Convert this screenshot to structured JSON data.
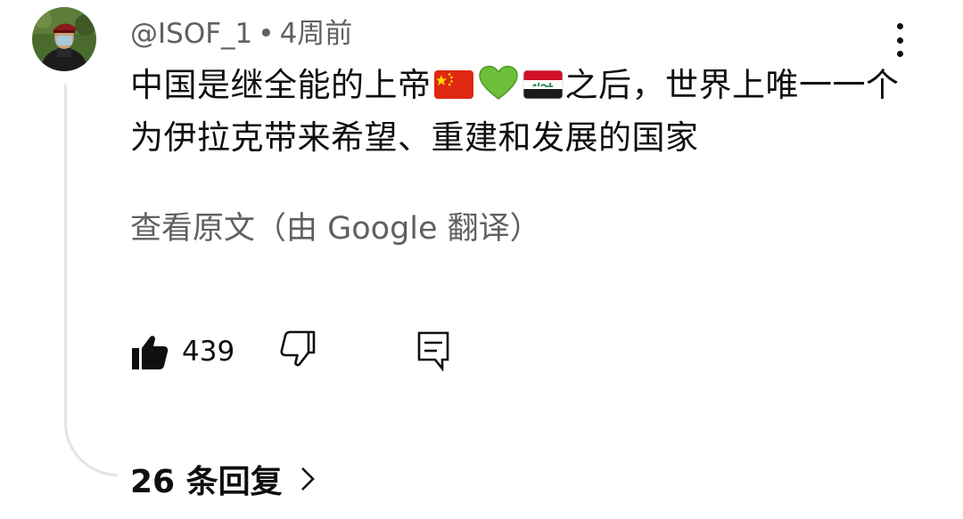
{
  "comment": {
    "author": "@ISOF_1",
    "separator": "•",
    "time": "4周前",
    "text_before_emoji": "中国是继全能的上帝",
    "emojis": [
      "china-flag-icon",
      "green-heart-icon",
      "iraq-flag-icon"
    ],
    "text_after_emoji": "之后，世界上唯一一个为伊拉克带来希望、重建和发展的国家",
    "translation_link": "查看原文（由 Google 翻译）",
    "like_count": "439",
    "replies_label": "26 条回复"
  },
  "colors": {
    "primary_text": "#0f0f0f",
    "secondary_text": "#606060",
    "thread_line": "#e4e4e4",
    "china_red": "#de2910",
    "china_yellow": "#ffde00",
    "iraq_red": "#ce1126",
    "iraq_green": "#007a3d",
    "heart_green": "#6dbf3a"
  },
  "icons": {
    "menu": "more-vert-icon",
    "like": "thumb-up-filled-icon",
    "dislike": "thumb-down-outline-icon",
    "reply": "comment-reply-icon",
    "expand": "chevron-right-icon"
  }
}
